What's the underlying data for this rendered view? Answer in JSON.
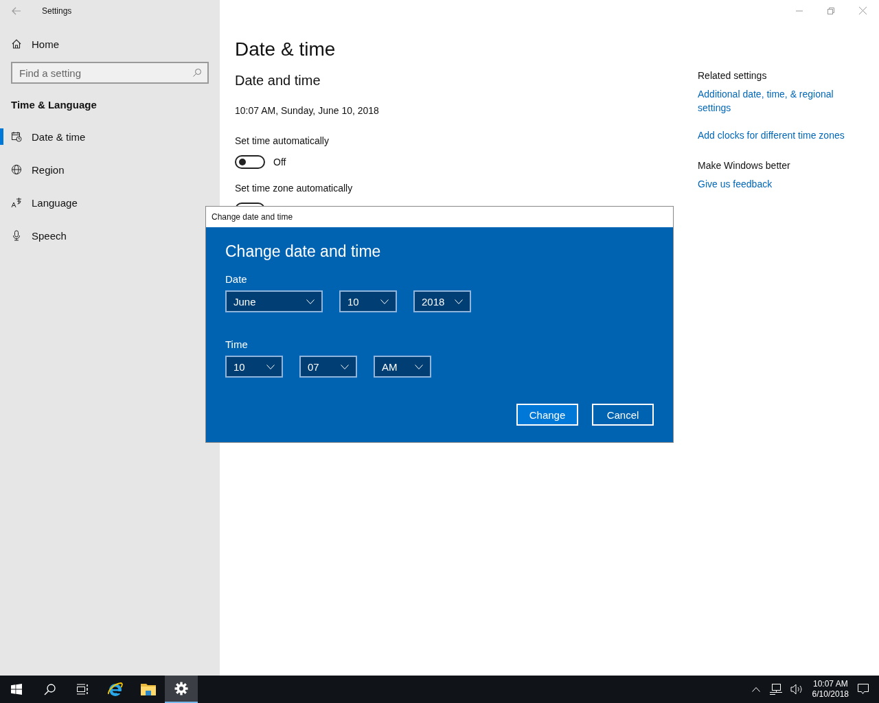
{
  "window": {
    "title": "Settings"
  },
  "sidebar": {
    "home": "Home",
    "search": {
      "placeholder": "Find a setting"
    },
    "section": "Time & Language",
    "items": [
      {
        "label": "Date & time",
        "kind": "calendar",
        "selected": true
      },
      {
        "label": "Region",
        "kind": "globe",
        "selected": false
      },
      {
        "label": "Language",
        "kind": "language",
        "selected": false
      },
      {
        "label": "Speech",
        "kind": "microphone",
        "selected": false
      }
    ]
  },
  "page": {
    "title": "Date & time",
    "section": "Date and time",
    "current": "10:07 AM, Sunday, June 10, 2018",
    "toggles": [
      {
        "label": "Set time automatically",
        "on": false,
        "state_text": "Off"
      },
      {
        "label": "Set time zone automatically",
        "on": false
      }
    ]
  },
  "related": [
    {
      "heading": "Related settings",
      "links": [
        "Additional date, time, & regional settings",
        "Add clocks for different time zones"
      ]
    },
    {
      "heading": "Make Windows better",
      "links": [
        "Give us feedback"
      ]
    }
  ],
  "dialog": {
    "title": "Change date and time",
    "heading": "Change date and time",
    "groups": [
      {
        "label": "Date",
        "fields": [
          "June",
          "10",
          "2018"
        ]
      },
      {
        "label": "Time",
        "fields": [
          "10",
          "07",
          "AM"
        ]
      }
    ],
    "buttons": [
      {
        "label": "Change",
        "kind": "primary"
      },
      {
        "label": "Cancel",
        "kind": "secondary"
      }
    ]
  },
  "taskbar": {
    "apps": [
      {
        "kind": "start",
        "selected": false
      },
      {
        "kind": "search",
        "selected": false
      },
      {
        "kind": "taskview",
        "selected": false
      },
      {
        "kind": "browser",
        "selected": false
      },
      {
        "kind": "folder",
        "selected": false
      },
      {
        "kind": "settings",
        "selected": true
      }
    ],
    "tray": {
      "time": "10:07 AM",
      "date": "6/10/2018"
    }
  }
}
